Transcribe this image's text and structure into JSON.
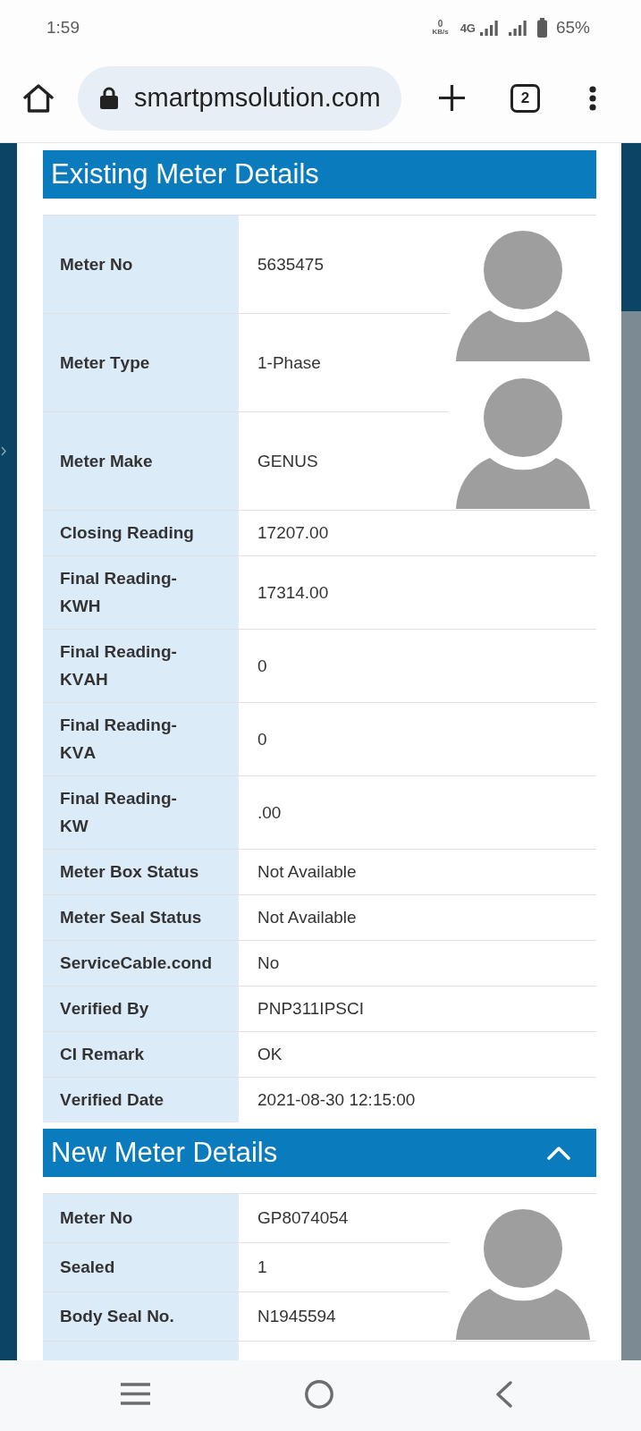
{
  "status_bar": {
    "time": "1:59",
    "speed_value": "0",
    "speed_unit": "KB/s",
    "network": "4G",
    "battery": "65%"
  },
  "browser": {
    "url": "smartpmsolution.com",
    "tab_count": "2"
  },
  "existing_meter": {
    "title": "Existing Meter Details",
    "photo_block": {
      "photos": [
        {
          "kind": "avatar"
        },
        {
          "kind": "avatar"
        }
      ],
      "rows": [
        {
          "label": "Meter No",
          "value": "5635475"
        },
        {
          "label": "Meter Type",
          "value": "1-Phase"
        },
        {
          "label": "Meter Make",
          "value": "GENUS"
        }
      ]
    },
    "rows": [
      {
        "kind": "field",
        "label": "Closing Reading",
        "value": "17207.00"
      },
      {
        "kind": "field",
        "label": "Final Reading-KWH",
        "value": "17314.00"
      },
      {
        "kind": "field",
        "label": "Final Reading-KVAH",
        "value": "0"
      },
      {
        "kind": "field",
        "label": "Final Reading-KVA",
        "value": "0"
      },
      {
        "kind": "field",
        "label": "Final Reading-KW",
        "value": ".00"
      },
      {
        "kind": "field",
        "label": "Meter Box Status",
        "value": "Not Available"
      },
      {
        "kind": "field",
        "label": "Meter Seal Status",
        "value": "Not Available"
      },
      {
        "kind": "field",
        "label": "ServiceCable.cond",
        "value": "No"
      },
      {
        "kind": "field",
        "label": "Verified By",
        "value": "PNP311IPSCI"
      },
      {
        "kind": "field",
        "label": "CI Remark",
        "value": "OK"
      },
      {
        "kind": "field",
        "label": "Verified Date",
        "value": "2021-08-30 12:15:00"
      }
    ]
  },
  "new_meter": {
    "title": "New Meter Details",
    "expanded": true,
    "photo_block": {
      "photos": [
        {
          "kind": "avatar"
        }
      ],
      "rows": [
        {
          "label": "Meter No",
          "value": "GP8074054"
        },
        {
          "label": "Sealed",
          "value": "1"
        },
        {
          "label": "Body Seal No.",
          "value": "N1945594"
        }
      ]
    },
    "rows": [
      {
        "kind": "cut_off"
      }
    ]
  }
}
